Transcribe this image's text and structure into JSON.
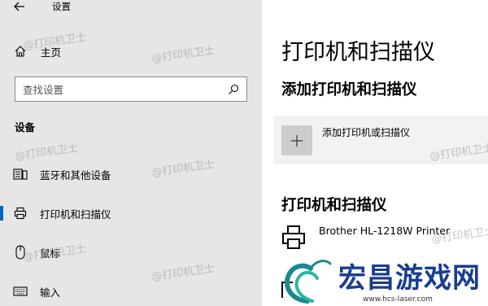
{
  "window": {
    "title": "设置"
  },
  "sidebar": {
    "home_label": "主页",
    "search_placeholder": "查找设置",
    "section_label": "设备",
    "items": [
      {
        "label": "蓝牙和其他设备",
        "icon": "keyboard-phone-icon",
        "active": false
      },
      {
        "label": "打印机和扫描仪",
        "icon": "printer-icon",
        "active": true
      },
      {
        "label": "鼠标",
        "icon": "mouse-icon",
        "active": false
      },
      {
        "label": "输入",
        "icon": "keyboard-icon",
        "active": false
      }
    ]
  },
  "main": {
    "title": "打印机和扫描仪",
    "add_section_title": "添加打印机和扫描仪",
    "add_button_label": "添加打印机或扫描仪",
    "list_section_title": "打印机和扫描仪",
    "printers": [
      {
        "name": "Brother HL-1218W Printer",
        "icon": "printer-icon"
      }
    ]
  },
  "watermark": {
    "text": "@打印机卫士"
  },
  "logo": {
    "text": "宏昌游戏网",
    "url": "www.hcs-laser.com"
  },
  "colors": {
    "accent": "#0067c0",
    "sidebar_bg": "#e6e6e6",
    "logo": "#1a3d8f"
  }
}
